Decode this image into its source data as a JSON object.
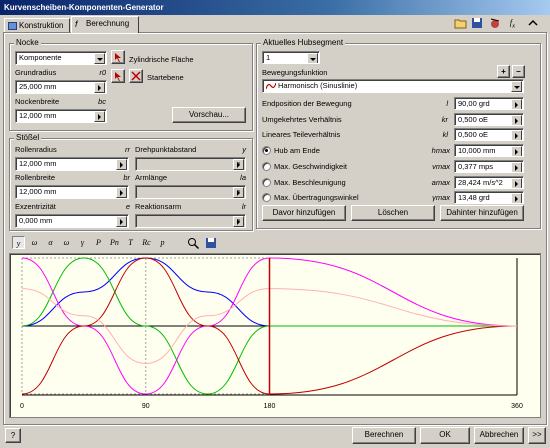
{
  "window": {
    "title": "Kurvenscheiben-Komponenten-Generator"
  },
  "tabs": [
    {
      "label": "Konstruktion"
    },
    {
      "label": "Berechnung"
    }
  ],
  "nocke": {
    "title": "Nocke",
    "type_value": "Komponente",
    "cylinder_label": "Zylindrische Fläche",
    "start_label": "Startebene",
    "grundradius_label": "Grundradius",
    "grundradius_sym": "r0",
    "grundradius_value": "25,000 mm",
    "nockenbreite_label": "Nockenbreite",
    "nockenbreite_sym": "bc",
    "nockenbreite_value": "12,000 mm",
    "preview_label": "Vorschau..."
  },
  "stoessel": {
    "title": "Stößel",
    "rollenradius_label": "Rollenradius",
    "rollenradius_sym": "rr",
    "rollenradius_value": "12,000 mm",
    "rollenbreite_label": "Rollenbreite",
    "rollenbreite_sym": "br",
    "rollenbreite_value": "12,000 mm",
    "exzentrizitaet_label": "Exzentrizität",
    "exzentrizitaet_sym": "e",
    "exzentrizitaet_value": "0,000 mm",
    "drehpunkt_label": "Drehpunktabstand",
    "drehpunkt_sym": "y",
    "armlaenge_label": "Armlänge",
    "armlaenge_sym": "la",
    "reaktionsarm_label": "Reaktionsarm",
    "reaktionsarm_sym": "lr"
  },
  "segment": {
    "title": "Aktuelles Hubsegment",
    "segment_value": "1",
    "function_label": "Bewegungsfunktion",
    "function_value": "Harmonisch (Sinuslinie)",
    "plus_label": "+",
    "minus_label": "–",
    "rows": [
      {
        "label": "Endposition der Bewegung",
        "sym": "l",
        "value": "90,00 grd"
      },
      {
        "label": "Umgekehrtes Verhältnis",
        "sym": "kr",
        "value": "0,500 oE"
      },
      {
        "label": "Lineares Teileverhältnis",
        "sym": "kl",
        "value": "0,500 oE"
      }
    ],
    "radio_rows": [
      {
        "label": "Hub am Ende",
        "sym": "hmax",
        "value": "10,000 mm",
        "selected": true
      },
      {
        "label": "Max. Geschwindigkeit",
        "sym": "vmax",
        "value": "0,377 mps",
        "selected": false
      },
      {
        "label": "Max. Beschleunigung",
        "sym": "amax",
        "value": "28,424 m/s^2",
        "selected": false
      },
      {
        "label": "Max. Übertragungswinkel",
        "sym": "γmax",
        "value": "13,48 grd",
        "selected": false
      }
    ],
    "btn_before": "Davor hinzufügen",
    "btn_delete": "Löschen",
    "btn_after": "Dahinter hinzufügen"
  },
  "graph_toolbar": [
    "y",
    "ω",
    "α",
    "ω",
    "γ",
    "P",
    "Pn",
    "T",
    "Rc",
    "p"
  ],
  "chart_data": {
    "type": "line",
    "x_ticks": [
      "0",
      "90",
      "180",
      "360"
    ],
    "xlim": [
      0,
      360
    ],
    "series": [
      {
        "color": "#0000ff",
        "x": [
          0,
          45,
          90,
          135,
          180,
          360
        ],
        "values": [
          0,
          0.5,
          1,
          0.5,
          0,
          0
        ]
      },
      {
        "color": "#00bb00",
        "x": [
          0,
          45,
          90,
          135,
          180,
          360
        ],
        "values": [
          0,
          1,
          0,
          -1,
          0,
          0
        ]
      },
      {
        "color": "#ff00ff",
        "x": [
          0,
          45,
          90,
          135,
          180,
          360
        ],
        "values": [
          1,
          0,
          -1,
          0,
          1,
          0
        ]
      },
      {
        "color": "#c00000",
        "x": [
          0,
          45,
          90,
          135,
          180,
          360
        ],
        "values": [
          -1,
          0,
          1,
          0,
          -1,
          0
        ]
      },
      {
        "color": "#ffb0b0",
        "x": [
          0,
          45,
          90,
          135,
          180,
          360
        ],
        "values": [
          0.55,
          0.15,
          -0.55,
          0.15,
          0.55,
          0
        ]
      }
    ]
  },
  "footer": {
    "help": "?",
    "calc": "Berechnen",
    "ok": "OK",
    "cancel": "Abbrechen",
    "more": ">>"
  }
}
